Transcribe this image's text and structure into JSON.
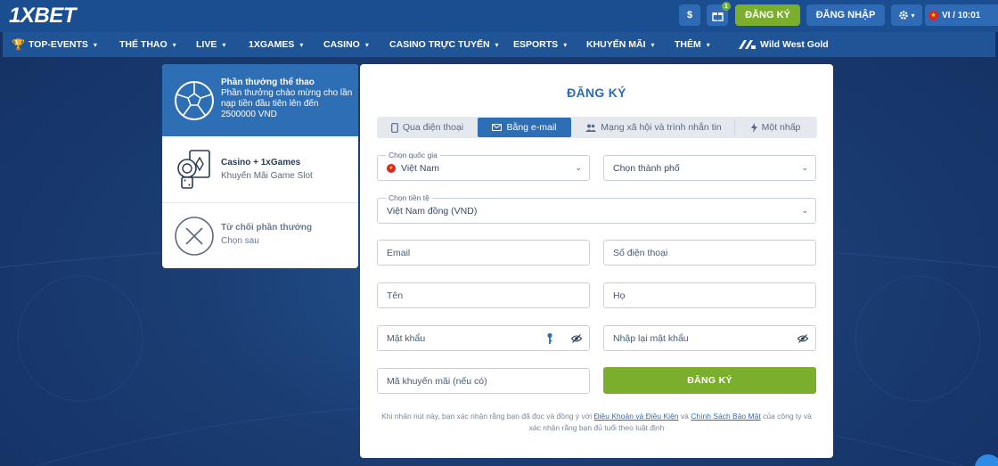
{
  "header": {
    "logo": "1XBET",
    "dollar_icon_glyph": "$",
    "gift_badge": "1",
    "register_label": "ĐĂNG KÝ",
    "login_label": "ĐĂNG NHẬP",
    "lang_time": "VI / 10:01"
  },
  "nav": {
    "items": [
      {
        "label": "TOP-EVENTS"
      },
      {
        "label": "THỂ THAO"
      },
      {
        "label": "LIVE"
      },
      {
        "label": "1XGAMES"
      },
      {
        "label": "CASINO"
      },
      {
        "label": "CASINO TRỰC TUYẾN"
      },
      {
        "label": "ESPORTS"
      },
      {
        "label": "KHUYẾN MÃI"
      },
      {
        "label": "THÊM"
      },
      {
        "label": "Wild West Gold"
      }
    ]
  },
  "bonus": {
    "items": [
      {
        "title": "Phần thưởng thể thao",
        "desc": "Phần thưởng chào mừng cho lần nạp tiền đầu tiên lên đến 2500000 VND"
      },
      {
        "title": "Casino + 1xGames",
        "desc": "Khuyến Mãi Game Slot"
      },
      {
        "title": "Từ chối phần thưởng",
        "desc": "Chọn sau"
      }
    ]
  },
  "form": {
    "title": "ĐĂNG KÝ",
    "tabs": [
      {
        "label": "Qua điện thoại"
      },
      {
        "label": "Bằng e-mail"
      },
      {
        "label": "Mạng xã hội và trình nhắn tin"
      },
      {
        "label": "Một nhấp"
      }
    ],
    "country_label": "Chọn quốc gia",
    "country_value": "Việt Nam",
    "city_placeholder": "Chọn thành phố",
    "currency_label": "Chọn tiền tệ",
    "currency_value": "Việt Nam đồng (VND)",
    "email_placeholder": "Email",
    "phone_placeholder": "Số điện thoại",
    "first_name_placeholder": "Tên",
    "last_name_placeholder": "Họ",
    "password_placeholder": "Mật khẩu",
    "password_repeat_placeholder": "Nhập lại mật khẩu",
    "promo_placeholder": "Mã khuyến mãi (nếu có)",
    "submit_label": "ĐĂNG KÝ",
    "disclaimer_1": "Khi nhấn nút này, bạn xác nhận rằng bạn đã đọc và đồng ý với",
    "terms_link": "Điều Khoản và Điều Kiện",
    "disclaimer_and": "và",
    "privacy_link": "Chính Sách Bảo Mật",
    "disclaimer_2": "của công ty và xác nhận rằng bạn đủ tuổi theo luật định"
  },
  "colors": {
    "primary": "#2e6eb5",
    "accent_green": "#7cae2e",
    "background": "#1b3a6b"
  }
}
